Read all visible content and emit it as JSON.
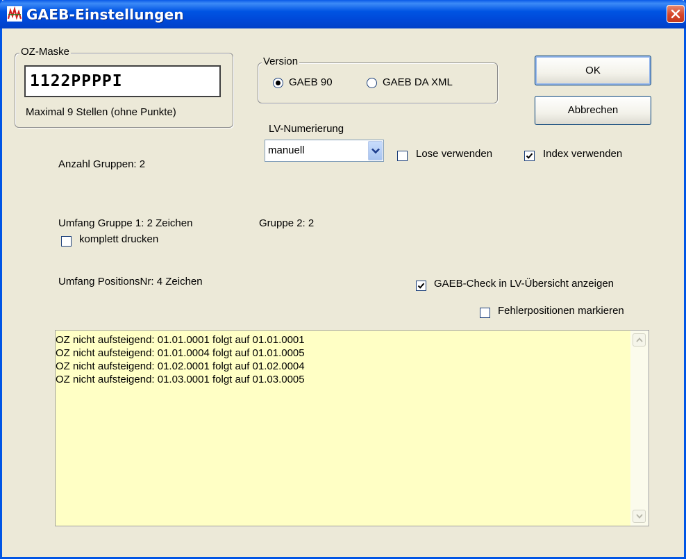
{
  "window": {
    "title": "GAEB-Einstellungen",
    "close_icon": "close-icon"
  },
  "oz_mask": {
    "group_label": "OZ-Maske",
    "value": "1122PPPPI",
    "hint": "Maximal 9 Stellen (ohne Punkte)"
  },
  "version": {
    "group_label": "Version",
    "options": [
      {
        "label": "GAEB 90",
        "selected": true
      },
      {
        "label": "GAEB DA XML",
        "selected": false
      }
    ]
  },
  "buttons": {
    "ok": "OK",
    "cancel": "Abbrechen"
  },
  "lv_numbering": {
    "label": "LV-Numerierung",
    "selected": "manuell"
  },
  "checkboxes": {
    "lose": {
      "label": "Lose verwenden",
      "checked": false
    },
    "index": {
      "label": "Index verwenden",
      "checked": true
    },
    "komplett": {
      "label": "komplett drucken",
      "checked": false
    },
    "gaeb_check": {
      "label": "GAEB-Check in LV-Übersicht anzeigen",
      "checked": true
    },
    "fehler": {
      "label": "Fehlerpositionen markieren",
      "checked": false
    }
  },
  "info": {
    "anzahl_gruppen": "Anzahl Gruppen: 2",
    "umfang_gruppe1": "Umfang Gruppe 1: 2 Zeichen",
    "gruppe2": "Gruppe 2: 2",
    "umfang_positions": "Umfang PositionsNr: 4 Zeichen"
  },
  "log": {
    "lines": [
      "OZ nicht aufsteigend: 01.01.0001 folgt auf 01.01.0001",
      "OZ nicht aufsteigend: 01.01.0004 folgt auf 01.01.0005",
      "OZ nicht aufsteigend: 01.02.0001 folgt auf 01.02.0004",
      "OZ nicht aufsteigend: 01.03.0001 folgt auf 01.03.0005"
    ]
  },
  "colors": {
    "titlebar": "#0054e3",
    "dialog_bg": "#ece9d8",
    "log_bg": "#ffffc5",
    "close_button": "#d6452a"
  }
}
